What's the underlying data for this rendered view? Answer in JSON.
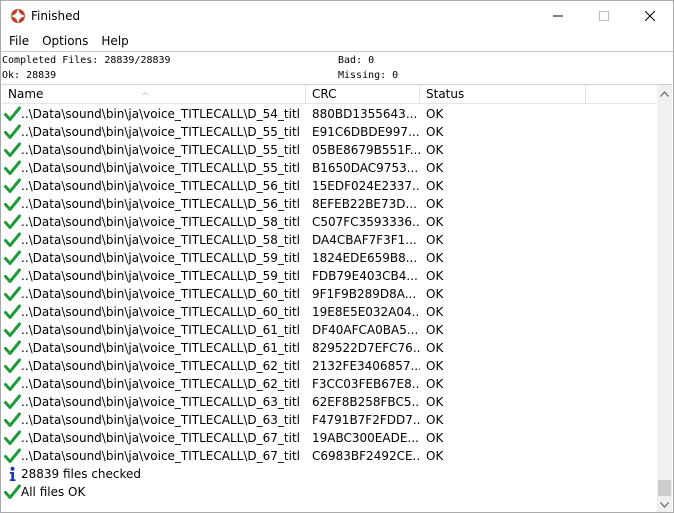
{
  "window": {
    "title": "Finished"
  },
  "menu": {
    "items": [
      "File",
      "Options",
      "Help"
    ]
  },
  "stats": {
    "completed": "Completed Files: 28839/28839",
    "ok": "Ok: 28839",
    "bad": "Bad: 0",
    "missing": "Missing: 0"
  },
  "columns": {
    "name": "Name",
    "crc": "CRC",
    "status": "Status"
  },
  "rows": [
    {
      "name": "..\\Data\\sound\\bin\\ja\\voice_TITLECALL\\D_54_titl...",
      "crc": "880BD1355643...",
      "status": "OK"
    },
    {
      "name": "..\\Data\\sound\\bin\\ja\\voice_TITLECALL\\D_55_titl...",
      "crc": "E91C6DBDE997...",
      "status": "OK"
    },
    {
      "name": "..\\Data\\sound\\bin\\ja\\voice_TITLECALL\\D_55_titl...",
      "crc": "05BE8679B551F...",
      "status": "OK"
    },
    {
      "name": "..\\Data\\sound\\bin\\ja\\voice_TITLECALL\\D_55_titl...",
      "crc": "B1650DAC9753...",
      "status": "OK"
    },
    {
      "name": "..\\Data\\sound\\bin\\ja\\voice_TITLECALL\\D_56_titl...",
      "crc": "15EDF024E2337...",
      "status": "OK"
    },
    {
      "name": "..\\Data\\sound\\bin\\ja\\voice_TITLECALL\\D_56_titl...",
      "crc": "8EFEB22BE73D...",
      "status": "OK"
    },
    {
      "name": "..\\Data\\sound\\bin\\ja\\voice_TITLECALL\\D_58_titl...",
      "crc": "C507FC3593336...",
      "status": "OK"
    },
    {
      "name": "..\\Data\\sound\\bin\\ja\\voice_TITLECALL\\D_58_titl...",
      "crc": "DA4CBAF7F3F1...",
      "status": "OK"
    },
    {
      "name": "..\\Data\\sound\\bin\\ja\\voice_TITLECALL\\D_59_titl...",
      "crc": "1824EDE659B8...",
      "status": "OK"
    },
    {
      "name": "..\\Data\\sound\\bin\\ja\\voice_TITLECALL\\D_59_titl...",
      "crc": "FDB79E403CB4...",
      "status": "OK"
    },
    {
      "name": "..\\Data\\sound\\bin\\ja\\voice_TITLECALL\\D_60_titl...",
      "crc": "9F1F9B289D8A...",
      "status": "OK"
    },
    {
      "name": "..\\Data\\sound\\bin\\ja\\voice_TITLECALL\\D_60_titl...",
      "crc": "19E8E5E032A04...",
      "status": "OK"
    },
    {
      "name": "..\\Data\\sound\\bin\\ja\\voice_TITLECALL\\D_61_titl...",
      "crc": "DF40AFCA0BA5...",
      "status": "OK"
    },
    {
      "name": "..\\Data\\sound\\bin\\ja\\voice_TITLECALL\\D_61_titl...",
      "crc": "829522D7EFC76...",
      "status": "OK"
    },
    {
      "name": "..\\Data\\sound\\bin\\ja\\voice_TITLECALL\\D_62_titl...",
      "crc": "2132FE3406857...",
      "status": "OK"
    },
    {
      "name": "..\\Data\\sound\\bin\\ja\\voice_TITLECALL\\D_62_titl...",
      "crc": "F3CC03FEB67E8...",
      "status": "OK"
    },
    {
      "name": "..\\Data\\sound\\bin\\ja\\voice_TITLECALL\\D_63_titl...",
      "crc": "62EF8B258FBC5...",
      "status": "OK"
    },
    {
      "name": "..\\Data\\sound\\bin\\ja\\voice_TITLECALL\\D_63_titl...",
      "crc": "F4791B7F2FDD7...",
      "status": "OK"
    },
    {
      "name": "..\\Data\\sound\\bin\\ja\\voice_TITLECALL\\D_67_titl...",
      "crc": "19ABC300EADE...",
      "status": "OK"
    },
    {
      "name": "..\\Data\\sound\\bin\\ja\\voice_TITLECALL\\D_67_titl...",
      "crc": "C6983BF2492CE...",
      "status": "OK"
    }
  ],
  "messages": [
    {
      "icon": "info-icon",
      "text": "28839 files checked"
    },
    {
      "icon": "check-icon",
      "text": "All files OK"
    }
  ],
  "colors": {
    "check": "#1e9b3c",
    "info": "#1a3bb8",
    "icon_ring": "#c0392b"
  }
}
